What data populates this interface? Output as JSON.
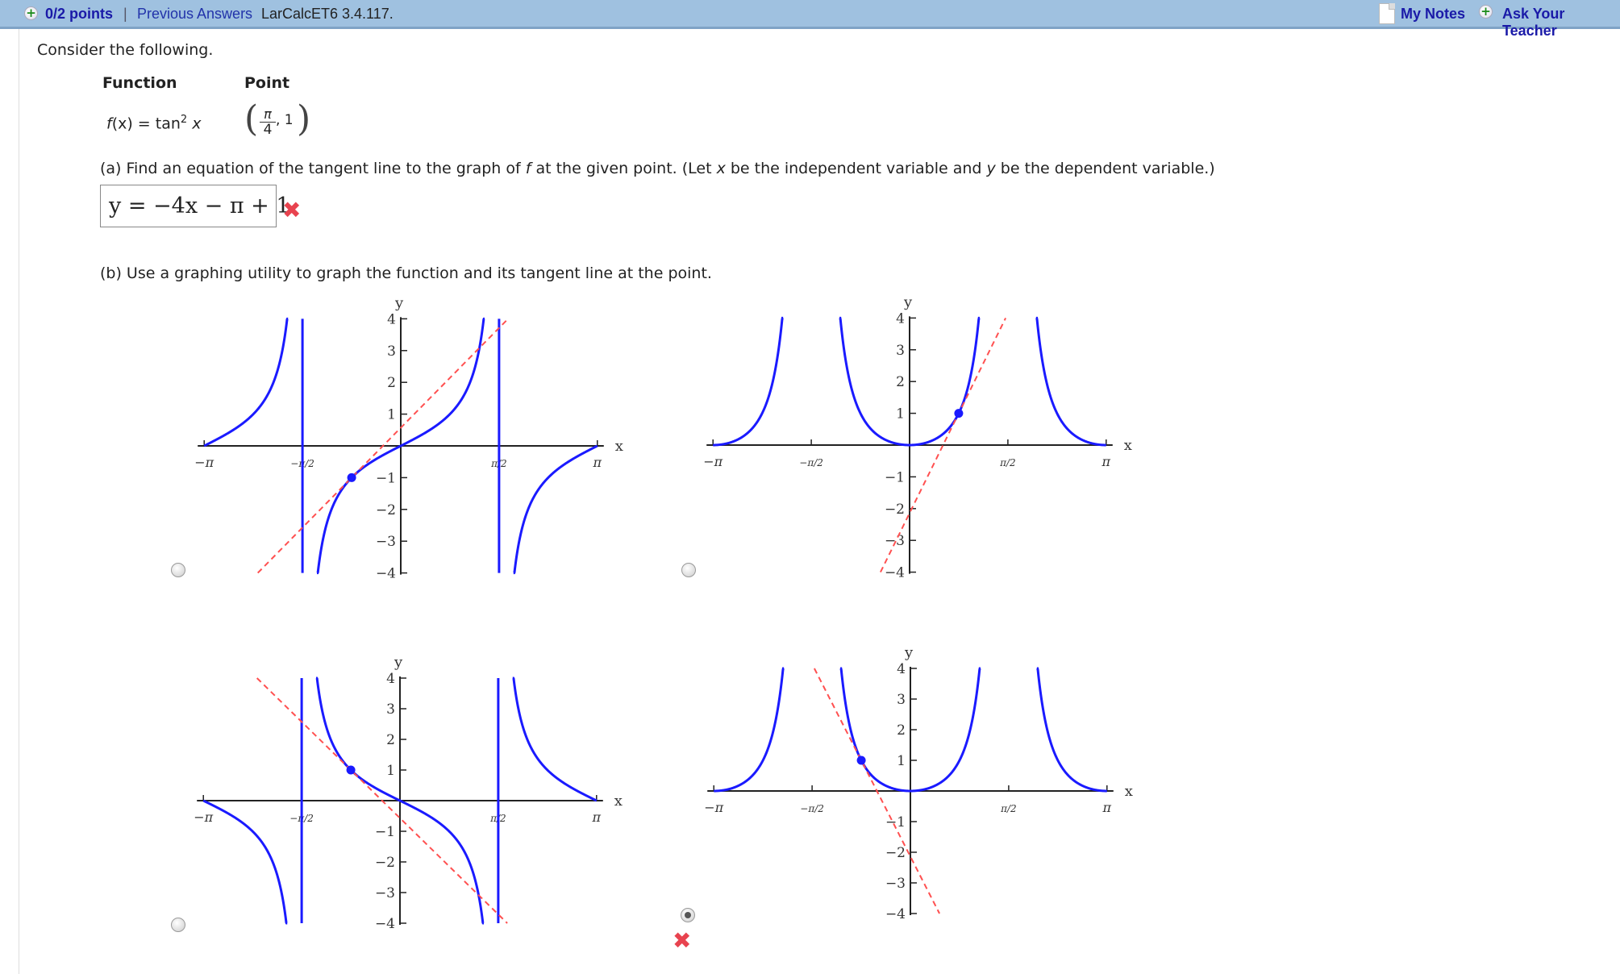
{
  "header": {
    "points": "0/2 points",
    "separator": "|",
    "previous_answers": "Previous Answers",
    "problem_code": "LarCalcET6 3.4.117.",
    "my_notes": "My Notes",
    "ask_teacher": "Ask Your Teacher"
  },
  "question": {
    "intro": "Consider the following.",
    "function_header": "Function",
    "point_header": "Point",
    "function_fx": "f",
    "function_rest": "(x) = tan",
    "function_exp": "2",
    "function_var": "x",
    "point_num": "π",
    "point_den": "4",
    "point_y": ", 1",
    "part_a_prefix": "(a) Find an equation of the tangent line to the graph of ",
    "part_a_f": "f",
    "part_a_mid1": " at the given point. (Let ",
    "part_a_x": "x",
    "part_a_mid2": " be the independent variable and ",
    "part_a_y": "y",
    "part_a_suffix": " be the dependent variable.)",
    "part_a_answer": "y = −4x − π + 1",
    "part_a_status": "incorrect",
    "part_b": "(b) Use a graphing utility to graph the function and its tangent line at the point.",
    "selected_option": 4,
    "option_status": "incorrect"
  },
  "icons": {
    "plus": "plus-circle-icon",
    "notes": "document-icon",
    "wrong": "x-mark-icon"
  },
  "colors": {
    "curve": "#1a1aff",
    "tangent": "#ff5050",
    "axis": "#222222",
    "header_bg": "#9fc1e0",
    "link": "#1a1aa8",
    "wrong": "#e8434f"
  },
  "chart_data": [
    {
      "type": "line",
      "option": 1,
      "title": "",
      "xlabel": "x",
      "ylabel": "y",
      "function": "tan(x)",
      "tangent": {
        "slope": 2,
        "point": [
          -0.785,
          -1
        ]
      },
      "xlim": [
        -3.1416,
        3.1416
      ],
      "ylim": [
        -4,
        4
      ],
      "xticks": [
        "−π",
        "−π/2",
        "π/2",
        "π"
      ],
      "yticks": [
        "4",
        "3",
        "2",
        "1",
        "−1",
        "−2",
        "−3",
        "−4"
      ],
      "asymptotes_drawn": true
    },
    {
      "type": "line",
      "option": 2,
      "title": "",
      "xlabel": "x",
      "ylabel": "y",
      "function": "tan^2(x)",
      "tangent": {
        "slope": 4,
        "point": [
          0.785,
          1
        ]
      },
      "xlim": [
        -3.1416,
        3.1416
      ],
      "ylim": [
        -4,
        4
      ],
      "xticks": [
        "−π",
        "−π/2",
        "π/2",
        "π"
      ],
      "yticks": [
        "4",
        "3",
        "2",
        "1",
        "−1",
        "−2",
        "−3",
        "−4"
      ],
      "asymptotes_drawn": false
    },
    {
      "type": "line",
      "option": 3,
      "title": "",
      "xlabel": "x",
      "ylabel": "y",
      "function": "-tan(x)",
      "tangent": {
        "slope": -2,
        "point": [
          -0.785,
          1
        ]
      },
      "xlim": [
        -3.1416,
        3.1416
      ],
      "ylim": [
        -4,
        4
      ],
      "xticks": [
        "−π",
        "−π/2",
        "π/2",
        "π"
      ],
      "yticks": [
        "4",
        "3",
        "2",
        "1",
        "−1",
        "−2",
        "−3",
        "−4"
      ],
      "asymptotes_drawn": true
    },
    {
      "type": "line",
      "option": 4,
      "title": "",
      "xlabel": "x",
      "ylabel": "y",
      "function": "tan^2(x)",
      "tangent": {
        "slope": -4,
        "point": [
          -0.785,
          1
        ]
      },
      "xlim": [
        -3.1416,
        3.1416
      ],
      "ylim": [
        -4,
        4
      ],
      "xticks": [
        "−π",
        "−π/2",
        "π/2",
        "π"
      ],
      "yticks": [
        "4",
        "3",
        "2",
        "1",
        "−1",
        "−2",
        "−3",
        "−4"
      ],
      "asymptotes_drawn": false
    }
  ]
}
